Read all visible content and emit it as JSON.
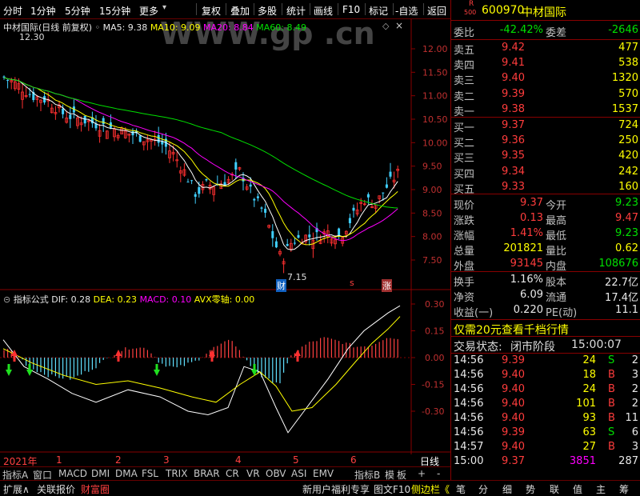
{
  "toolbar": {
    "items": [
      "分时",
      "1分钟",
      "5分钟",
      "15分钟",
      "更多",
      "复权",
      "叠加",
      "多股",
      "统计",
      "画线",
      "F10",
      "标记",
      "-自选",
      "返回"
    ]
  },
  "chart_legend": {
    "title": "中材国际(日线 前复权)",
    "ma5": "MA5: 9.38",
    "ma10": "MA10: 9.09",
    "ma20": "MA20: 8.84",
    "ma60": "MA60: 8.49",
    "high_label": "12.30",
    "low_label": "7.15",
    "marker_cai": "财",
    "marker_s": "s",
    "marker_zhang": "涨"
  },
  "price_axis": [
    "12.00",
    "11.50",
    "11.00",
    "10.50",
    "10.00",
    "9.50",
    "9.00",
    "8.50",
    "8.00",
    "7.50"
  ],
  "indicator_legend": {
    "name": "指标公式",
    "dif": "DIF: 0.28",
    "dea": "DEA: 0.23",
    "macd": "MACD: 0.10",
    "avx": "AVX零轴: 0.00"
  },
  "macd_axis": [
    "0.30",
    "0.15",
    "0.00",
    "-0.15",
    "-0.30"
  ],
  "time_axis": {
    "year": "2021年",
    "months": [
      "1",
      "2",
      "3",
      "4",
      "5",
      "6"
    ],
    "period": "日线"
  },
  "indicator_tabs": [
    "指标A",
    "窗口",
    "MACD",
    "DMI",
    "DMA",
    "FSL",
    "TRIX",
    "BRAR",
    "CR",
    "VR",
    "OBV",
    "ASI",
    "EMV",
    "指标B",
    "模",
    "板",
    "+",
    "-"
  ],
  "status_bar": {
    "left": [
      "扩展∧",
      "关联报价",
      "财富圈"
    ],
    "promo": "新用户福利专享",
    "tuwen": "图文F10",
    "sidebar": "侧边栏《",
    "tools": [
      "笔",
      "分",
      "细",
      "势",
      "联",
      "值",
      "主",
      "筹"
    ]
  },
  "quote": {
    "code": "600970",
    "name": "中材国际",
    "r_badge": "R",
    "r_sub": "500",
    "weibi_label": "委比",
    "weibi": "-42.42%",
    "weicha_label": "委差",
    "weicha": "-2646",
    "asks": [
      {
        "label": "卖五",
        "price": "9.42",
        "vol": "477"
      },
      {
        "label": "卖四",
        "price": "9.41",
        "vol": "538"
      },
      {
        "label": "卖三",
        "price": "9.40",
        "vol": "1320"
      },
      {
        "label": "卖二",
        "price": "9.39",
        "vol": "570"
      },
      {
        "label": "卖一",
        "price": "9.38",
        "vol": "1537"
      }
    ],
    "bids": [
      {
        "label": "买一",
        "price": "9.37",
        "vol": "724"
      },
      {
        "label": "买二",
        "price": "9.36",
        "vol": "250"
      },
      {
        "label": "买三",
        "price": "9.35",
        "vol": "420"
      },
      {
        "label": "买四",
        "price": "9.34",
        "vol": "242"
      },
      {
        "label": "买五",
        "price": "9.33",
        "vol": "160"
      }
    ],
    "stats": [
      {
        "l1": "现价",
        "v1": "9.37",
        "c1": "red",
        "l2": "今开",
        "v2": "9.23",
        "c2": "green"
      },
      {
        "l1": "涨跌",
        "v1": "0.13",
        "c1": "red",
        "l2": "最高",
        "v2": "9.47",
        "c2": "red"
      },
      {
        "l1": "涨幅",
        "v1": "1.41%",
        "c1": "red",
        "l2": "最低",
        "v2": "9.23",
        "c2": "green"
      },
      {
        "l1": "总量",
        "v1": "201821",
        "c1": "yellow",
        "l2": "量比",
        "v2": "0.62",
        "c2": "yellow"
      },
      {
        "l1": "外盘",
        "v1": "93145",
        "c1": "red",
        "l2": "内盘",
        "v2": "108676",
        "c2": "green"
      }
    ],
    "stats2": [
      {
        "l1": "换手",
        "v1": "1.16%",
        "l2": "股本",
        "v2": "22.7亿"
      },
      {
        "l1": "净资",
        "v1": "6.09",
        "l2": "流通",
        "v2": "17.4亿"
      },
      {
        "l1": "收益(一)",
        "v1": "0.220",
        "l2": "PE(动)",
        "v2": "11.1"
      }
    ],
    "promo": "仅需20元查看千档行情",
    "trade_state_label": "交易状态:",
    "trade_state": "闭市阶段",
    "trade_time": "15:00:07",
    "ticks": [
      {
        "t": "14:56",
        "p": "9.39",
        "pc": "red",
        "v": "24",
        "d": "S",
        "dc": "green",
        "n": "2"
      },
      {
        "t": "14:56",
        "p": "9.40",
        "pc": "red",
        "v": "18",
        "d": "B",
        "dc": "red",
        "n": "3"
      },
      {
        "t": "14:56",
        "p": "9.40",
        "pc": "red",
        "v": "24",
        "d": "B",
        "dc": "red",
        "n": "2"
      },
      {
        "t": "14:56",
        "p": "9.40",
        "pc": "red",
        "v": "101",
        "d": "B",
        "dc": "red",
        "n": "2"
      },
      {
        "t": "14:56",
        "p": "9.40",
        "pc": "red",
        "v": "93",
        "d": "B",
        "dc": "red",
        "n": "11"
      },
      {
        "t": "14:56",
        "p": "9.39",
        "pc": "red",
        "v": "63",
        "d": "S",
        "dc": "green",
        "n": "6"
      },
      {
        "t": "14:57",
        "p": "9.40",
        "pc": "red",
        "v": "27",
        "d": "B",
        "dc": "red",
        "n": "3"
      },
      {
        "t": "15:00",
        "p": "9.37",
        "pc": "red",
        "v": "3851",
        "d": "",
        "dc": "red",
        "n": "287"
      }
    ]
  }
}
